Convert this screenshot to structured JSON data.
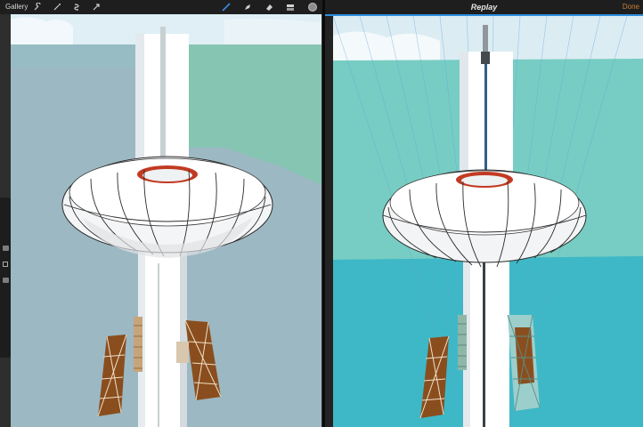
{
  "left": {
    "toolbar": {
      "gallery_label": "Gallery",
      "tools": [
        {
          "name": "wrench-icon",
          "active": false
        },
        {
          "name": "magic-wand-icon",
          "active": false
        },
        {
          "name": "selection-icon",
          "active": false
        },
        {
          "name": "transform-icon",
          "active": false
        },
        {
          "name": "brush-icon",
          "active": true
        },
        {
          "name": "smudge-icon",
          "active": false
        },
        {
          "name": "eraser-icon",
          "active": false
        },
        {
          "name": "layers-icon",
          "active": false
        }
      ],
      "color_swatch": "#8d8d8d"
    }
  },
  "right": {
    "toolbar": {
      "title": "Replay",
      "done_label": "Done"
    },
    "replay_progress": 1.0
  },
  "colors": {
    "accent": "#2d8ee0",
    "done": "#c8803a",
    "left_sky": "#9cb8c3",
    "left_green": "#87c5b3",
    "right_sea": "#5bc7c8",
    "tower_red": "#c8331b"
  }
}
